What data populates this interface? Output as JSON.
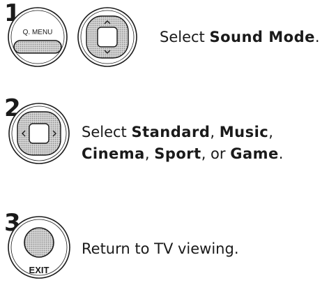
{
  "steps": [
    {
      "number": "1",
      "buttons": {
        "qmenu_label": "Q. MENU"
      },
      "text": {
        "prefix": "Select ",
        "bold": "Sound Mode",
        "suffix": "."
      }
    },
    {
      "number": "2",
      "text": {
        "prefix": "Select ",
        "opt1": "Standard",
        "sep1": ", ",
        "opt2": "Music",
        "sep2": ",",
        "opt3": "Cinema",
        "sep3": ", ",
        "opt4": "Sport",
        "sep4": ", or ",
        "opt5": "Game",
        "suffix": "."
      }
    },
    {
      "number": "3",
      "buttons": {
        "exit_label": "EXIT"
      },
      "text": {
        "full": "Return to TV viewing."
      }
    }
  ],
  "icons": {
    "stipple_fill": "#bdbdbd",
    "outline": "#1a1a1a"
  }
}
